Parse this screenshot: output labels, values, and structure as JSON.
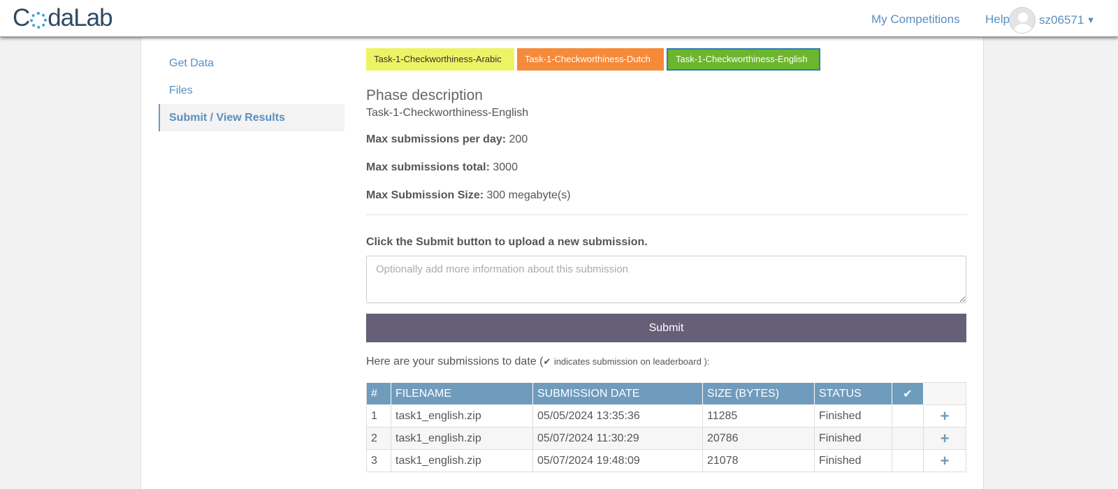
{
  "header": {
    "logo_text_start": "C",
    "logo_text_end": "daLab",
    "nav": {
      "my_competitions": "My Competitions",
      "help": "Help"
    },
    "username": "sz06571"
  },
  "sidebar": {
    "items": [
      {
        "label": "Get Data",
        "active": false
      },
      {
        "label": "Files",
        "active": false
      },
      {
        "label": "Submit / View Results",
        "active": true
      }
    ]
  },
  "phase_tabs": [
    {
      "label": "Task-1-Checkworthiness-Arabic",
      "color": "#eef365"
    },
    {
      "label": "Task-1-Checkworthiness-Dutch",
      "color": "#f58a3a"
    },
    {
      "label": "Task-1-Checkworthiness-English",
      "color": "#6cb52e",
      "selected": true
    }
  ],
  "phase": {
    "heading": "Phase description",
    "name": "Task-1-Checkworthiness-English",
    "max_per_day_label": "Max submissions per day:",
    "max_per_day_value": "200",
    "max_total_label": "Max submissions total:",
    "max_total_value": "3000",
    "max_size_label": "Max Submission Size:",
    "max_size_value": "300 megabyte(s)"
  },
  "submit": {
    "hint": "Click the Submit button to upload a new submission.",
    "placeholder": "Optionally add more information about this submission",
    "button_label": "Submit"
  },
  "submissions": {
    "intro_start": "Here are your submissions to date (",
    "intro_note": "indicates submission on leaderboard ):",
    "columns": [
      "#",
      "FILENAME",
      "SUBMISSION DATE",
      "SIZE (BYTES)",
      "STATUS",
      "✔"
    ],
    "rows": [
      {
        "num": "1",
        "filename": "task1_english.zip",
        "date": "05/05/2024 13:35:36",
        "size": "11285",
        "status": "Finished"
      },
      {
        "num": "2",
        "filename": "task1_english.zip",
        "date": "05/07/2024 11:30:29",
        "size": "20786",
        "status": "Finished"
      },
      {
        "num": "3",
        "filename": "task1_english.zip",
        "date": "05/07/2024 19:48:09",
        "size": "21078",
        "status": "Finished"
      }
    ]
  }
}
